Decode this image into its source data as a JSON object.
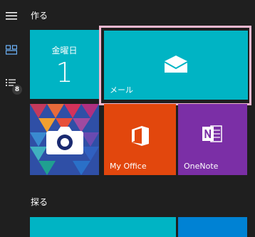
{
  "sections": {
    "create_label": "作る",
    "explore_label": "探る"
  },
  "tiles": {
    "calendar": {
      "day": "金曜日",
      "date": "1"
    },
    "mail": {
      "label": "メール"
    },
    "office": {
      "label": "My Office"
    },
    "onenote": {
      "label": "OneNote"
    }
  },
  "rail": {
    "badge_count": "8"
  },
  "colors": {
    "background": "#1f1f1f",
    "teal": "#00b4c4",
    "office_orange": "#e2470d",
    "onenote_purple": "#7b2fa6",
    "focus": "#f2b8d0",
    "blue": "#0082d4"
  },
  "icons": [
    "hamburger-icon",
    "tiles-icon",
    "list-icon",
    "mail-icon",
    "camera-icon",
    "office-icon",
    "onenote-icon"
  ]
}
